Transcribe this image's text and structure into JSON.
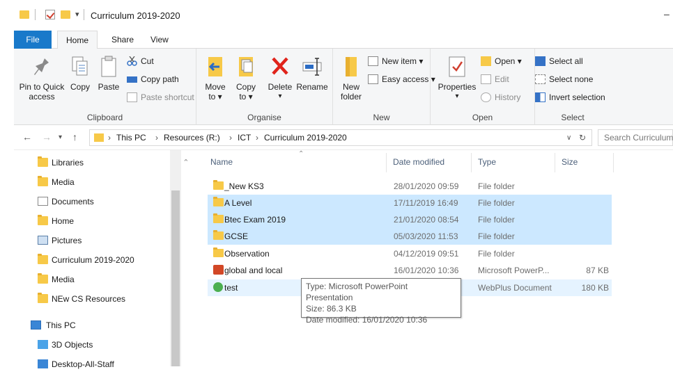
{
  "window": {
    "title": "Curriculum 2019-2020"
  },
  "tabs": {
    "file": "File",
    "home": "Home",
    "share": "Share",
    "view": "View"
  },
  "ribbon": {
    "clipboard": {
      "label": "Clipboard",
      "pin_l1": "Pin to Quick",
      "pin_l2": "access",
      "copy": "Copy",
      "paste": "Paste",
      "cut": "Cut",
      "copy_path": "Copy path",
      "paste_shortcut": "Paste shortcut"
    },
    "organise": {
      "label": "Organise",
      "move_l1": "Move",
      "move_l2": "to ▾",
      "copy_l1": "Copy",
      "copy_l2": "to ▾",
      "delete_l1": "Delete",
      "delete_l2": "▾",
      "rename": "Rename"
    },
    "new": {
      "label": "New",
      "folder_l1": "New",
      "folder_l2": "folder",
      "new_item": "New item ▾",
      "easy_access": "Easy access ▾"
    },
    "open": {
      "label": "Open",
      "properties": "Properties",
      "properties_arrow": "▾",
      "open": "Open ▾",
      "edit": "Edit",
      "history": "History"
    },
    "select": {
      "label": "Select",
      "select_all": "Select all",
      "select_none": "Select none",
      "invert": "Invert selection"
    }
  },
  "address": {
    "crumbs": [
      "This PC",
      "Resources (R:)",
      "ICT",
      "Curriculum 2019-2020"
    ],
    "search_placeholder": "Search Curriculum"
  },
  "navpane": {
    "items": [
      {
        "label": "Libraries",
        "icon": "folder-icon"
      },
      {
        "label": "Media",
        "icon": "folder-icon"
      },
      {
        "label": "Documents",
        "icon": "documents-icon"
      },
      {
        "label": "Home",
        "icon": "folder-icon"
      },
      {
        "label": "Pictures",
        "icon": "pictures-icon"
      },
      {
        "label": "Curriculum 2019-2020",
        "icon": "folder-icon"
      },
      {
        "label": "Media",
        "icon": "folder-icon"
      },
      {
        "label": "NEw CS Resources",
        "icon": "folder-icon"
      }
    ],
    "this_pc": "This PC",
    "objects_3d": "3D Objects",
    "desktop": "Desktop-All-Staff"
  },
  "columns": {
    "name": "Name",
    "date": "Date modified",
    "type": "Type",
    "size": "Size"
  },
  "files": [
    {
      "name": "_New KS3",
      "date": "28/01/2020 09:59",
      "type": "File folder",
      "size": "",
      "icon": "folder-icon",
      "selected": false
    },
    {
      "name": "A Level",
      "date": "17/11/2019 16:49",
      "type": "File folder",
      "size": "",
      "icon": "folder-icon",
      "selected": true
    },
    {
      "name": "Btec Exam 2019",
      "date": "21/01/2020 08:54",
      "type": "File folder",
      "size": "",
      "icon": "folder-icon",
      "selected": true
    },
    {
      "name": "GCSE",
      "date": "05/03/2020 11:53",
      "type": "File folder",
      "size": "",
      "icon": "folder-icon",
      "selected": true
    },
    {
      "name": "Observation",
      "date": "04/12/2019 09:51",
      "type": "File folder",
      "size": "",
      "icon": "folder-icon",
      "selected": false
    },
    {
      "name": "global and local",
      "date": "16/01/2020 10:36",
      "type": "Microsoft PowerP...",
      "size": "87 KB",
      "icon": "powerpoint-icon",
      "selected": false
    },
    {
      "name": "test",
      "date": "",
      "type": "WebPlus Document",
      "size": "180 KB",
      "icon": "webplus-icon",
      "selected": false
    }
  ],
  "tooltip": {
    "type": "Type: Microsoft PowerPoint Presentation",
    "size": "Size: 86.3 KB",
    "date": "Date modified: 16/01/2020 10:36"
  },
  "colors": {
    "accent": "#1979ca",
    "selection": "#cce8ff",
    "folder": "#f7c948"
  }
}
